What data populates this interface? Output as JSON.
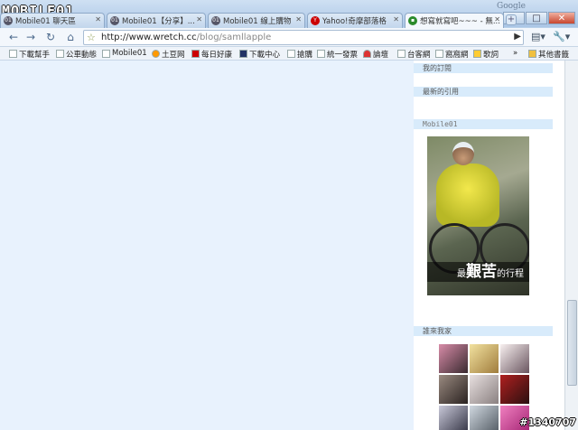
{
  "watermark_logo": "MOBILE01",
  "title_google": "Google",
  "window_buttons": {
    "minimize": "–",
    "maximize": "□",
    "close": "✕"
  },
  "tabs": [
    {
      "label": "Mobile01 聊天區",
      "icon": "mobile01-favicon"
    },
    {
      "label": "Mobile01【分享】...",
      "icon": "mobile01-favicon"
    },
    {
      "label": "Mobile01 線上購物",
      "icon": "mobile01-favicon"
    },
    {
      "label": "Yahoo!奇摩部落格",
      "icon": "yahoo-favicon"
    },
    {
      "label": "想寫就寫吧~~~ - 無...",
      "icon": "page-favicon",
      "active": true
    }
  ],
  "new_tab": "+",
  "toolbar": {
    "back": "←",
    "forward": "→",
    "reload": "↻",
    "home": "⌂",
    "url_host": "http://www.wretch.cc",
    "url_path": "/blog/samllapple",
    "go": "▶",
    "page_menu": "▤▾",
    "tools_menu": "🔧▾"
  },
  "bookmarks": [
    "下載幫手",
    "公車動態",
    "Mobile01",
    "土豆网",
    "每日好康",
    "下載中心",
    "搶購",
    "統一發票",
    "論壇",
    "台客網",
    "窩窩網",
    "歌詞"
  ],
  "bookmarks_more": "»",
  "bookmarks_other": "其他書籤",
  "sidebar": {
    "sections": [
      "我的訂閱",
      "最新的引用",
      "Mobile01",
      "誰來我家"
    ],
    "ad_caption_small_before": "最",
    "ad_caption_big": "艱苦",
    "ad_caption_small_after": "的行程"
  },
  "watermark_id": "#1340707"
}
